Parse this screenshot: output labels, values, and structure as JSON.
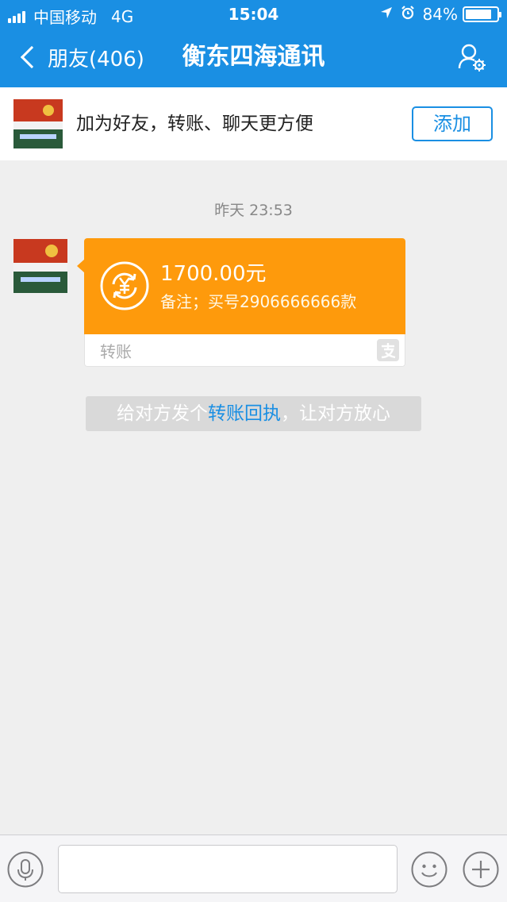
{
  "status_bar": {
    "carrier": "中国移动",
    "network": "4G",
    "time": "15:04",
    "battery_percent": "84%",
    "battery_level": 0.84,
    "icons": [
      "signal-icon",
      "location-arrow-icon",
      "alarm-icon",
      "battery-icon"
    ]
  },
  "nav": {
    "back_label": "朋友(406)",
    "title": "衡东四海通讯",
    "settings_icon": "user-settings-icon"
  },
  "add_banner": {
    "text": "加为好友，转账、聊天更方便",
    "button_label": "添加"
  },
  "chat": {
    "timestamp": "昨天 23:53",
    "transfer": {
      "amount": "1700.00元",
      "note": "备注；买号2906666666款",
      "label": "转账",
      "icon": "yuan-transfer-icon",
      "brand_icon": "alipay-icon"
    },
    "receipt_tip": {
      "prefix": "给对方发个",
      "link": "转账回执",
      "suffix": "，让对方放心"
    }
  },
  "toolbar": {
    "input_value": "",
    "icons": [
      "microphone-icon",
      "emoji-icon",
      "plus-icon"
    ]
  },
  "colors": {
    "brand_blue": "#1a8fe3",
    "transfer_orange": "#fe9a0c",
    "background": "#efefef"
  }
}
